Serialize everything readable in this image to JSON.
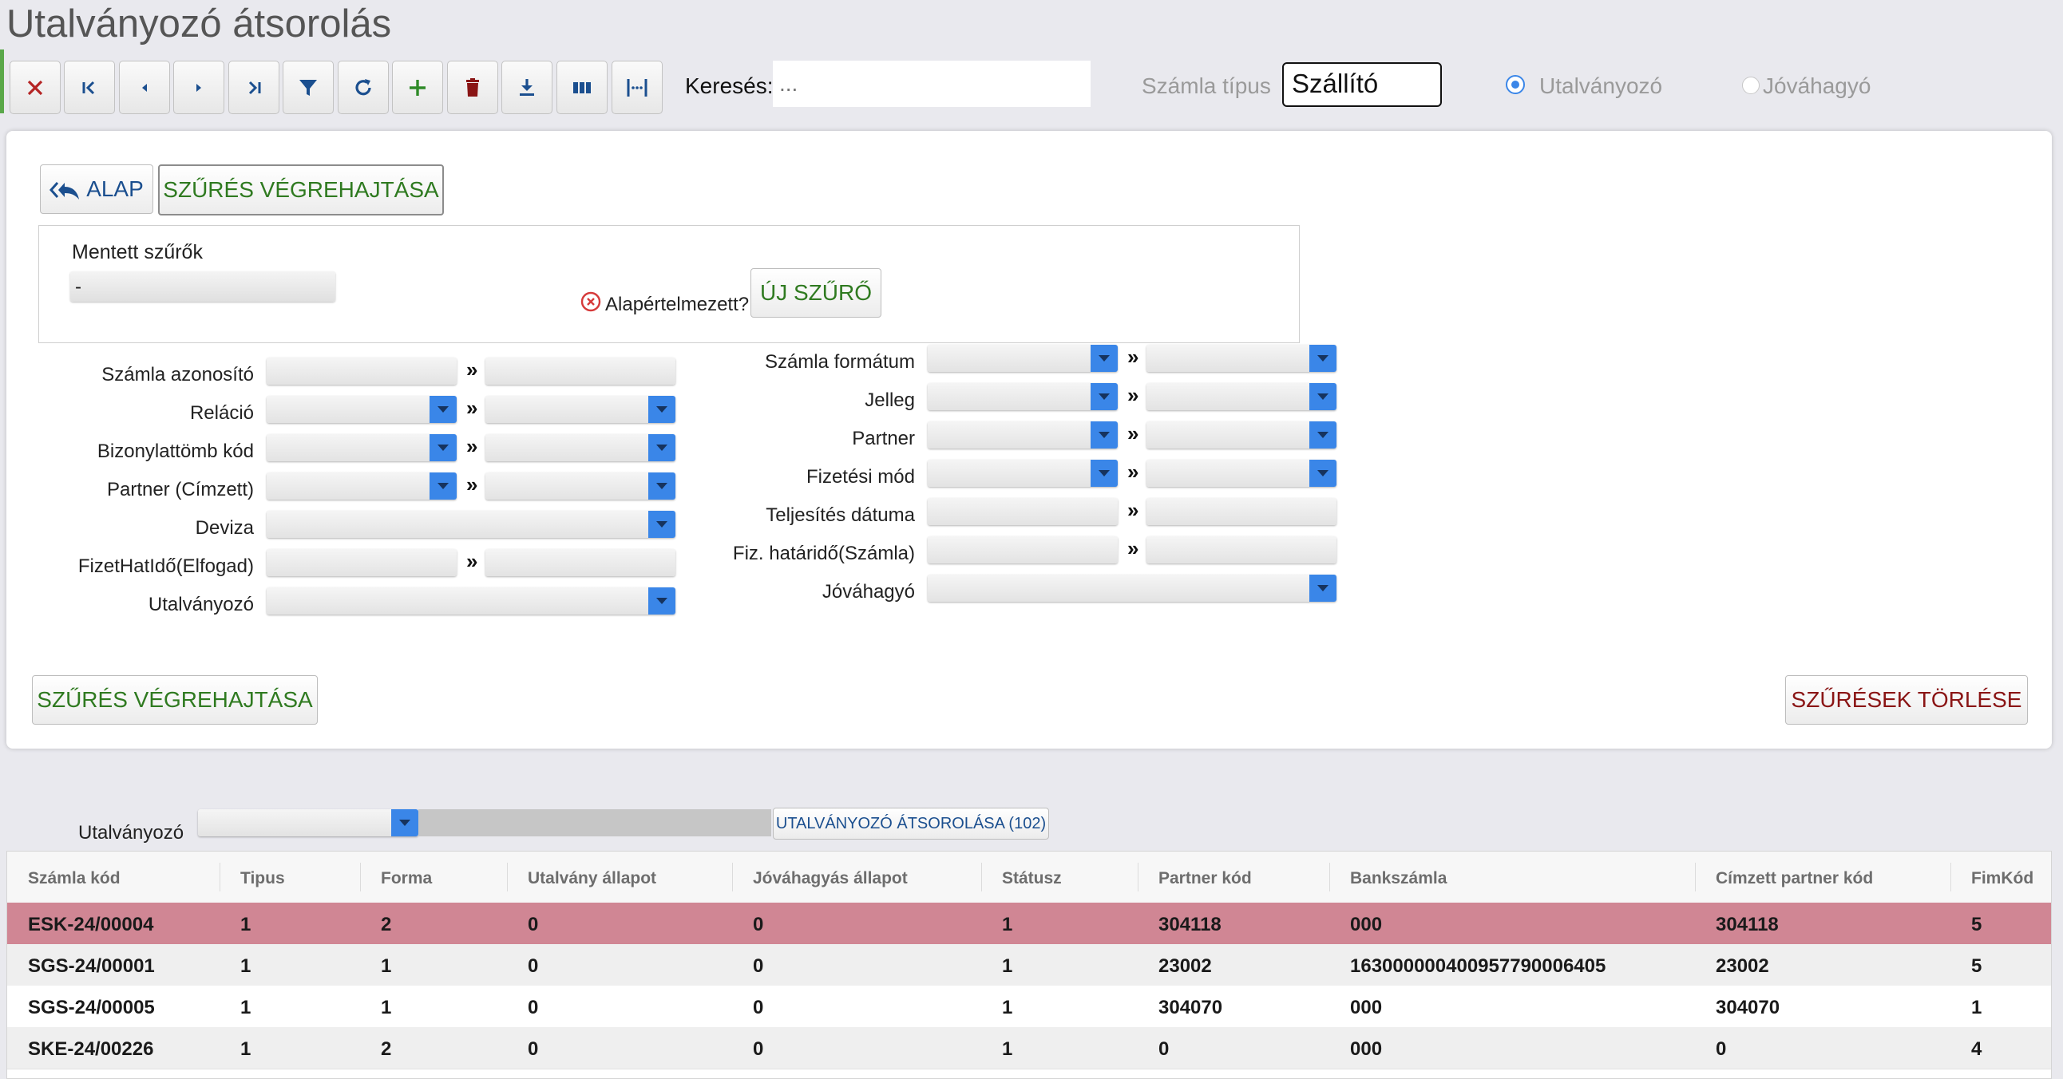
{
  "page": {
    "title": "Utalványozó átsorolás"
  },
  "toolbar": {
    "search_label": "Keresés:",
    "search_placeholder": "...",
    "invoice_type_label": "Számla típus",
    "invoice_type_value": "Szállító",
    "radio_issuer_label": "Utalványozó",
    "radio_approver_label": "Jóváhagyó",
    "accent_color": "#3a86e8"
  },
  "filter": {
    "basic_button": "ALAP",
    "apply_top_button": "SZŰRÉS VÉGREHAJTÁSA",
    "saved_filters_label": "Mentett szűrők",
    "saved_filters_value": "-",
    "default_label": "Alapértelmezett?",
    "new_filter_button": "ÚJ SZŰRŐ",
    "range_separator": "»",
    "left_fields": {
      "invoice_id": "Számla azonosító",
      "relation": "Reláció",
      "document_block": "Bizonylattömb kód",
      "partner_addressee": "Partner (Címzett)",
      "currency": "Deviza",
      "payment_deadline_accept": "FizetHatIdő(Elfogad)",
      "issuer": "Utalványozó"
    },
    "right_fields": {
      "invoice_format": "Számla formátum",
      "nature": "Jelleg",
      "partner": "Partner",
      "payment_method": "Fizetési mód",
      "completion_date": "Teljesítés dátuma",
      "payment_deadline_invoice": "Fiz. határidő(Számla)",
      "approver": "Jóváhagyó"
    },
    "apply_bottom_button": "SZŰRÉS VÉGREHAJTÁSA",
    "clear_button": "SZŰRÉSEK TÖRLÉSE"
  },
  "reassign": {
    "label": "Utalványozó",
    "button": "UTALVÁNYOZÓ ÁTSOROLÁSA (102)"
  },
  "table": {
    "columns": {
      "invoice_code": "Számla kód",
      "type": "Tipus",
      "form": "Forma",
      "voucher_state": "Utalvány állapot",
      "approval_state": "Jóváhagyás állapot",
      "status": "Státusz",
      "partner_code": "Partner kód",
      "bank_account": "Bankszámla",
      "addressee_partner_code": "Címzett partner kód",
      "fim_code": "FimKód"
    },
    "rows": [
      {
        "invoice_code": "ESK-24/00004",
        "type": "1",
        "form": "2",
        "voucher_state": "0",
        "approval_state": "0",
        "status": "1",
        "partner_code": "304118",
        "bank_account": "000",
        "addressee_partner_code": "304118",
        "fim_code": "5",
        "selected": true
      },
      {
        "invoice_code": "SGS-24/00001",
        "type": "1",
        "form": "1",
        "voucher_state": "0",
        "approval_state": "0",
        "status": "1",
        "partner_code": "23002",
        "bank_account": "16300000040095779000640‌5",
        "addressee_partner_code": "23002",
        "fim_code": "5",
        "selected": false
      },
      {
        "invoice_code": "SGS-24/00005",
        "type": "1",
        "form": "1",
        "voucher_state": "0",
        "approval_state": "0",
        "status": "1",
        "partner_code": "304070",
        "bank_account": "000",
        "addressee_partner_code": "304070",
        "fim_code": "1",
        "selected": false
      },
      {
        "invoice_code": "SKE-24/00226",
        "type": "1",
        "form": "2",
        "voucher_state": "0",
        "approval_state": "0",
        "status": "1",
        "partner_code": "0",
        "bank_account": "000",
        "addressee_partner_code": "0",
        "fim_code": "4",
        "selected": false
      }
    ],
    "selected_row_color": "#d08694"
  }
}
